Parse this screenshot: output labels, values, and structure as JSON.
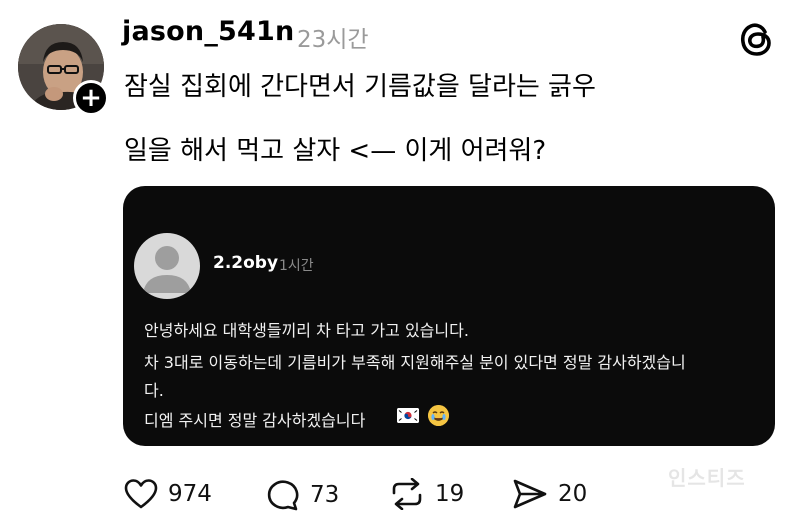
{
  "post": {
    "username": "jason_541n",
    "time": "23시간",
    "text_line1": "잠실 집회에 간다면서 기름값을 달라는 긁우",
    "text_line2": "일을 해서 먹고 살자 <— 이게 어려워?"
  },
  "embed": {
    "username": "2.2oby",
    "time": "1시간",
    "lines": [
      "안녕하세요 대학생들끼리 차 타고 가고 있습니다.",
      "차 3대로 이동하는데 기름비가 부족해 지원해주실 분이 있다면 정말 감사하겠습니",
      "다.",
      "디엠 주시면 정말 감사하겠습니다"
    ]
  },
  "actions": {
    "like_count": "974",
    "comment_count": "73",
    "repost_count": "19",
    "share_count": "20"
  },
  "watermark": "인스티즈",
  "icons": {
    "brand": "threads-logo-icon",
    "like": "heart-icon",
    "comment": "comment-bubble-icon",
    "repost": "repost-icon",
    "share": "send-icon",
    "follow": "plus-icon"
  },
  "colors": {
    "embed_bg": "#0b0b0b",
    "muted": "#9a9a9a"
  }
}
